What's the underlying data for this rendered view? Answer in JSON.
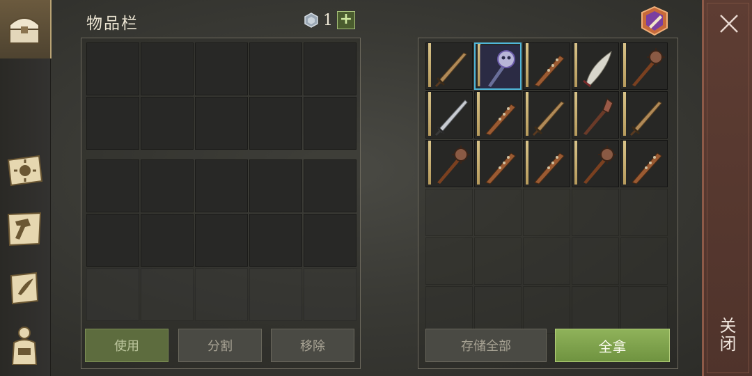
{
  "inventory": {
    "title": "物品栏",
    "currency_value": "1",
    "currency_add": "+"
  },
  "buttons": {
    "use": "使用",
    "split": "分割",
    "remove": "移除",
    "store_all": "存储全部",
    "take_all": "全拿"
  },
  "close": {
    "label": "关闭"
  },
  "nav_icons": [
    "chest-icon",
    "journal-sun-icon",
    "crafting-hammer-icon",
    "quest-scroll-icon",
    "character-equipment-icon"
  ],
  "loot_slots": [
    {
      "item": "sword",
      "selected": false
    },
    {
      "item": "skull-mace",
      "selected": true
    },
    {
      "item": "spiked-club",
      "selected": false
    },
    {
      "item": "scimitar",
      "selected": false
    },
    {
      "item": "morning-star",
      "selected": false
    },
    {
      "item": "steel-sword",
      "selected": false
    },
    {
      "item": "spiked-club",
      "selected": false
    },
    {
      "item": "sword",
      "selected": false
    },
    {
      "item": "flanged-mace",
      "selected": false
    },
    {
      "item": "sword",
      "selected": false
    },
    {
      "item": "morning-star",
      "selected": false
    },
    {
      "item": "spiked-club",
      "selected": false
    },
    {
      "item": "spiked-club",
      "selected": false
    },
    {
      "item": "morning-star",
      "selected": false
    },
    {
      "item": "spiked-club",
      "selected": false
    }
  ],
  "colors": {
    "accent_green": "#8fb25a",
    "close_red": "#5e3d33",
    "selected_border": "#4fb6d8"
  }
}
